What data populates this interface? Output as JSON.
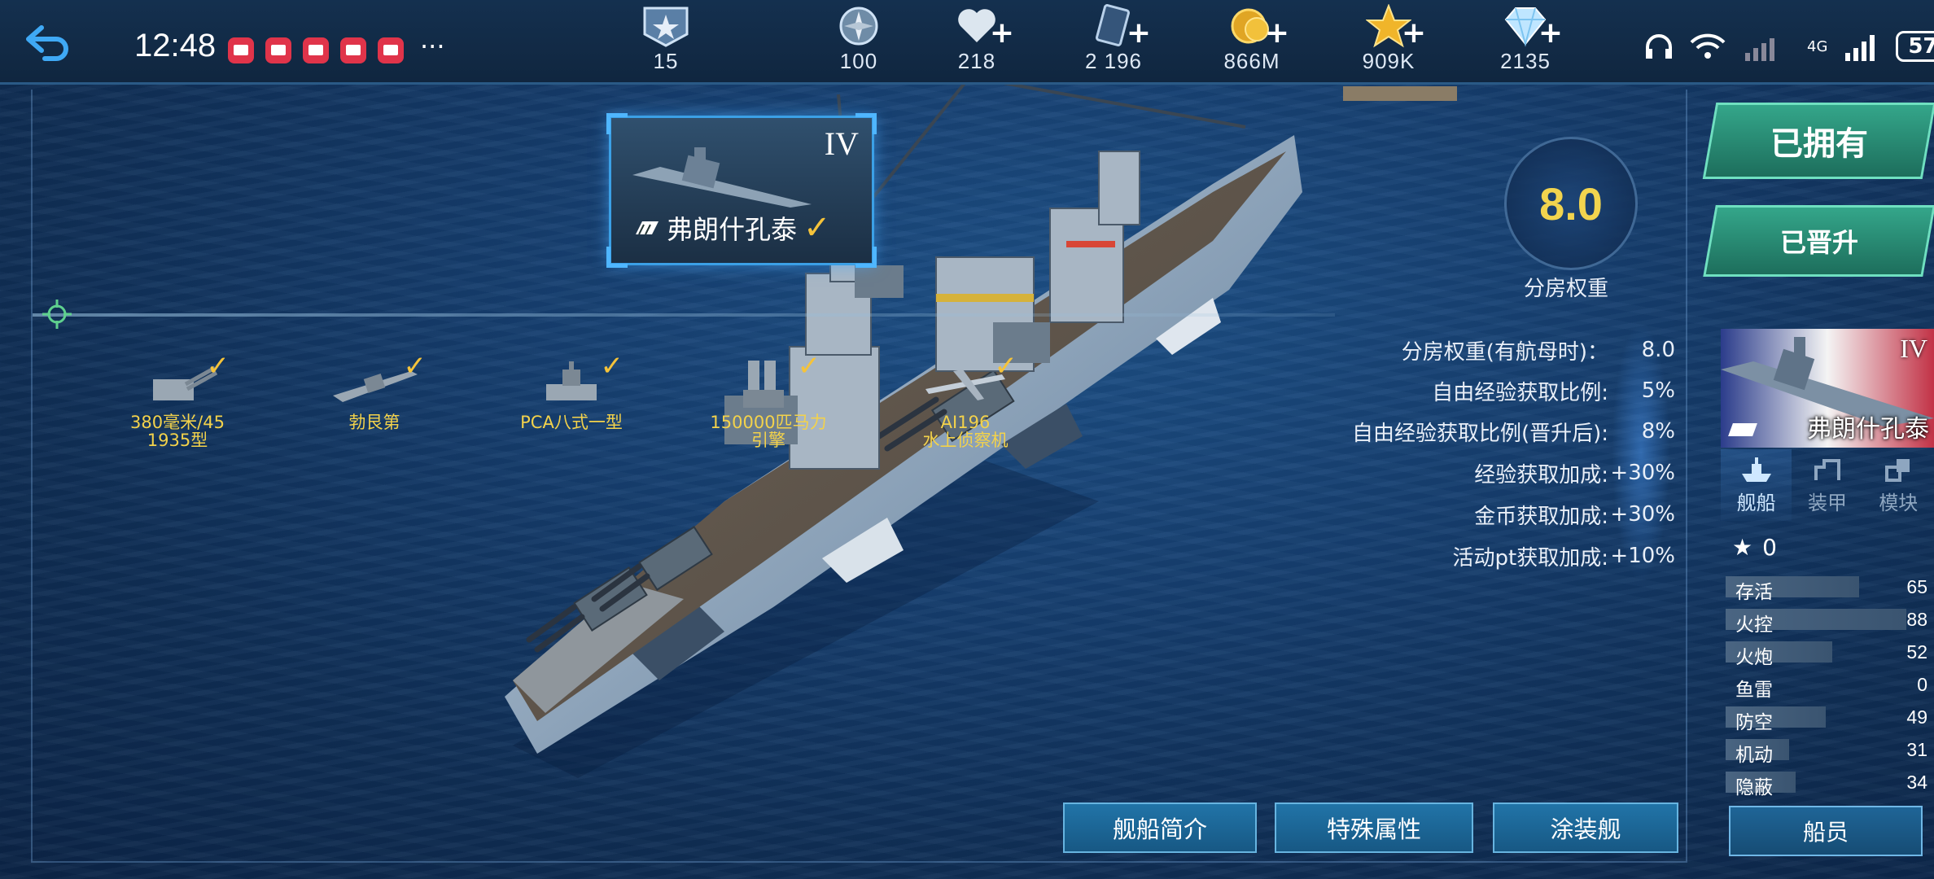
{
  "status": {
    "time": "12:48",
    "more": "···",
    "battery": "57",
    "signal": "4G"
  },
  "resources": [
    {
      "icon": "rank-emblem-icon",
      "value": "15",
      "plus": false
    },
    {
      "icon": "compass-icon",
      "value": "100",
      "plus": false
    },
    {
      "icon": "heart-icon",
      "value": "218",
      "plus": true
    },
    {
      "icon": "card-icon",
      "value": "2 196",
      "plus": true
    },
    {
      "icon": "gold-coin-icon",
      "value": "866M",
      "plus": true
    },
    {
      "icon": "star-icon",
      "value": "909K",
      "plus": true
    },
    {
      "icon": "diamond-icon",
      "value": "2135",
      "plus": true
    }
  ],
  "selected_ship": {
    "tier": "IV",
    "name": "弗朗什孔泰"
  },
  "room_weight": {
    "value": "8.0",
    "label": "分房权重"
  },
  "equipment": [
    {
      "label": "380毫米/45\n1935型"
    },
    {
      "label": "勃艮第"
    },
    {
      "label": "PCA八式一型"
    },
    {
      "label": "150000匹马力\n引擎"
    },
    {
      "label": "AI196\n水上侦察机"
    }
  ],
  "stats": [
    {
      "key": "分房权重(有航母时)：",
      "value": "8.0"
    },
    {
      "key": "自由经验获取比例:",
      "value": "5%"
    },
    {
      "key": "自由经验获取比例(晋升后):",
      "value": "8%"
    },
    {
      "key": "经验获取加成:",
      "value": "+30%"
    },
    {
      "key": "金币获取加成:",
      "value": "+30%"
    },
    {
      "key": "活动pt获取加成:",
      "value": "+10%"
    }
  ],
  "buttons": {
    "owned": "已拥有",
    "upgraded": "已晋升",
    "intro": "舰船简介",
    "special": "特殊属性",
    "skin": "涂装舰",
    "crew": "船员"
  },
  "panel": {
    "tier": "IV",
    "name": "弗朗什孔泰",
    "tabs": [
      {
        "label": "舰船",
        "icon": "ship-icon"
      },
      {
        "label": "装甲",
        "icon": "armor-icon"
      },
      {
        "label": "模块",
        "icon": "module-icon"
      }
    ],
    "stars": "0",
    "attributes": [
      {
        "name": "存活",
        "value": "65",
        "fill": 0.65
      },
      {
        "name": "火控",
        "value": "88",
        "fill": 0.88
      },
      {
        "name": "火炮",
        "value": "52",
        "fill": 0.52
      },
      {
        "name": "鱼雷",
        "value": "0",
        "fill": 0
      },
      {
        "name": "防空",
        "value": "49",
        "fill": 0.49
      },
      {
        "name": "机动",
        "value": "31",
        "fill": 0.31
      },
      {
        "name": "隐蔽",
        "value": "34",
        "fill": 0.34
      }
    ]
  },
  "colors": {
    "accent_gold": "#f5c33a",
    "button_green": "#34a68a",
    "button_blue": "#2174a8"
  }
}
